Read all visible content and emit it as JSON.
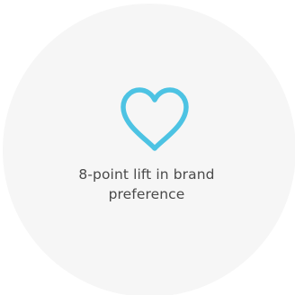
{
  "stat": {
    "icon": "heart-outline-icon",
    "accent_color": "#4dc3e3",
    "background_color": "#f6f6f6",
    "caption_line1": "8-point lift in brand",
    "caption_line2": "preference"
  }
}
